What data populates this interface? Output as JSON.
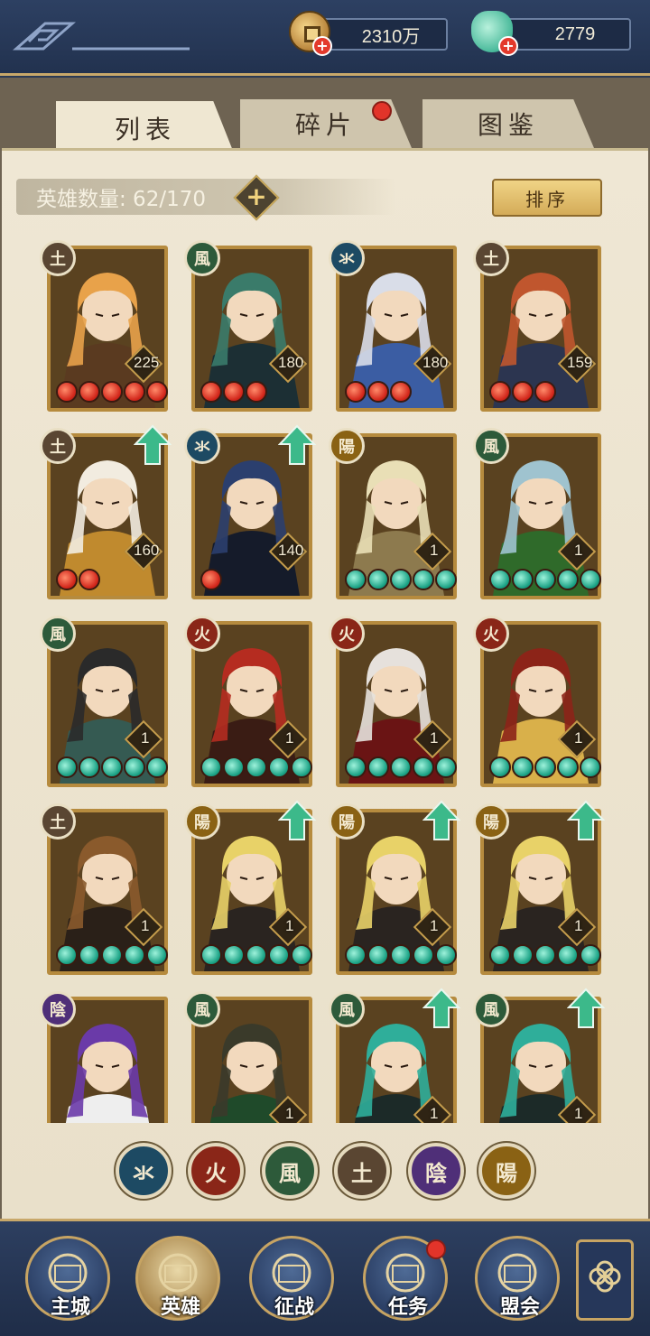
{
  "currency": {
    "coin": "2310万",
    "jade": "2779"
  },
  "tabs": [
    {
      "label": "列表",
      "active": true
    },
    {
      "label": "碎片",
      "badge": true
    },
    {
      "label": "图鉴"
    }
  ],
  "hero_count": "英雄数量: 62/170",
  "sort_label": "排序",
  "elements": {
    "water": {
      "glyph": "氺",
      "color": "#1d4a63"
    },
    "fire": {
      "glyph": "火",
      "color": "#8a2618"
    },
    "wind": {
      "glyph": "風",
      "color": "#2d5a3a"
    },
    "earth": {
      "glyph": "土",
      "color": "#5a4632"
    },
    "yin": {
      "glyph": "陰",
      "color": "#4f2f78"
    },
    "yang": {
      "glyph": "陽",
      "color": "#8a6214"
    }
  },
  "heroes": [
    {
      "element": "earth",
      "level": "225",
      "stars": 5,
      "star_type": "red",
      "up": false,
      "palette": [
        "#e8a24a",
        "#5a3a20"
      ]
    },
    {
      "element": "wind",
      "level": "180",
      "stars": 3,
      "star_type": "red",
      "up": false,
      "palette": [
        "#3a7b6a",
        "#1c2f34"
      ]
    },
    {
      "element": "water",
      "level": "180",
      "stars": 3,
      "star_type": "red",
      "up": false,
      "palette": [
        "#d9dde8",
        "#3b5da3"
      ]
    },
    {
      "element": "earth",
      "level": "159",
      "stars": 3,
      "star_type": "red",
      "up": false,
      "palette": [
        "#c0562e",
        "#2c3550"
      ]
    },
    {
      "element": "earth",
      "level": "160",
      "stars": 2,
      "star_type": "red",
      "up": true,
      "palette": [
        "#f2ece0",
        "#c08a2e"
      ]
    },
    {
      "element": "water",
      "level": "140",
      "stars": 1,
      "star_type": "red",
      "up": true,
      "palette": [
        "#2b3f6e",
        "#151b2a"
      ]
    },
    {
      "element": "yang",
      "level": "1",
      "stars": 5,
      "star_type": "jade",
      "up": false,
      "palette": [
        "#e9dfb6",
        "#8d7a4e"
      ]
    },
    {
      "element": "wind",
      "level": "1",
      "stars": 5,
      "star_type": "jade",
      "up": false,
      "palette": [
        "#9fc3cf",
        "#2f6a2a"
      ]
    },
    {
      "element": "wind",
      "level": "1",
      "stars": 5,
      "star_type": "jade",
      "up": false,
      "palette": [
        "#2a2a2a",
        "#355a52"
      ]
    },
    {
      "element": "fire",
      "level": "1",
      "stars": 5,
      "star_type": "jade",
      "up": false,
      "palette": [
        "#b52c20",
        "#3a1c14"
      ]
    },
    {
      "element": "fire",
      "level": "1",
      "stars": 5,
      "star_type": "jade",
      "up": false,
      "palette": [
        "#e6e1dc",
        "#6a1414"
      ]
    },
    {
      "element": "fire",
      "level": "1",
      "stars": 5,
      "star_type": "jade",
      "up": false,
      "palette": [
        "#8c2418",
        "#d9b04a"
      ]
    },
    {
      "element": "earth",
      "level": "1",
      "stars": 5,
      "star_type": "jade",
      "up": false,
      "palette": [
        "#8a5a2c",
        "#2a2018"
      ]
    },
    {
      "element": "yang",
      "level": "1",
      "stars": 5,
      "star_type": "jade",
      "up": true,
      "palette": [
        "#e8d268",
        "#2a2420"
      ]
    },
    {
      "element": "yang",
      "level": "1",
      "stars": 5,
      "star_type": "jade",
      "up": true,
      "palette": [
        "#e8d268",
        "#2a2420"
      ]
    },
    {
      "element": "yang",
      "level": "1",
      "stars": 5,
      "star_type": "jade",
      "up": true,
      "palette": [
        "#e8d268",
        "#2a2420"
      ]
    },
    {
      "element": "yin",
      "level": "",
      "stars": 0,
      "star_type": "jade",
      "up": false,
      "palette": [
        "#6a3aa8",
        "#eeeeee"
      ]
    },
    {
      "element": "wind",
      "level": "1",
      "stars": 0,
      "star_type": "jade",
      "up": false,
      "palette": [
        "#3a3a2a",
        "#1f4a2a"
      ]
    },
    {
      "element": "wind",
      "level": "1",
      "stars": 0,
      "star_type": "jade",
      "up": true,
      "palette": [
        "#2fae9a",
        "#1c2a28"
      ]
    },
    {
      "element": "wind",
      "level": "1",
      "stars": 0,
      "star_type": "jade",
      "up": true,
      "palette": [
        "#2fae9a",
        "#1c2a28"
      ]
    }
  ],
  "filters": [
    "water",
    "fire",
    "wind",
    "earth",
    "yin",
    "yang"
  ],
  "nav": [
    {
      "label": "主城",
      "icon": "palace-icon"
    },
    {
      "label": "英雄",
      "icon": "hero-portrait-icon",
      "active": true
    },
    {
      "label": "征战",
      "icon": "battle-icon"
    },
    {
      "label": "任务",
      "icon": "scroll-icon",
      "badge": true
    },
    {
      "label": "盟会",
      "icon": "alliance-icon"
    }
  ]
}
